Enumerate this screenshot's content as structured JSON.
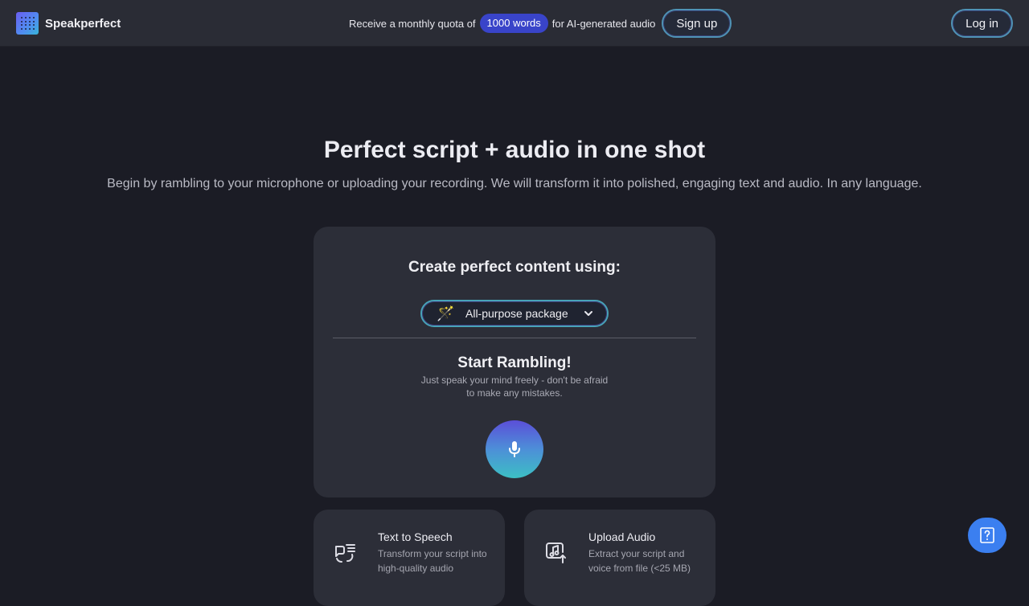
{
  "brand": {
    "name": "Speakperfect"
  },
  "promo": {
    "prefix": "Receive a monthly quota of",
    "highlight": "1000 words",
    "suffix": "for AI-generated audio",
    "signup_label": "Sign up"
  },
  "header": {
    "login_label": "Log in"
  },
  "hero": {
    "title": "Perfect script + audio in one shot",
    "subtitle": "Begin by rambling to your microphone or uploading your recording. We will transform it into polished, engaging text and audio. In any language."
  },
  "card": {
    "title": "Create perfect content using:",
    "package": {
      "icon": "magic-wand-icon",
      "label": "All-purpose package"
    },
    "ramble_title": "Start Rambling!",
    "ramble_sub": "Just speak your mind freely - don't be afraid to make any mistakes."
  },
  "options": [
    {
      "icon": "text-to-speech-icon",
      "title": "Text to Speech",
      "desc": "Transform your script into high-quality audio"
    },
    {
      "icon": "upload-audio-icon",
      "title": "Upload Audio",
      "desc": "Extract your script and voice from file (<25 MB)"
    }
  ],
  "colors": {
    "accent": "#3944c9",
    "background": "#1b1c25",
    "card": "#2c2e38",
    "help": "#3b7ff0"
  }
}
